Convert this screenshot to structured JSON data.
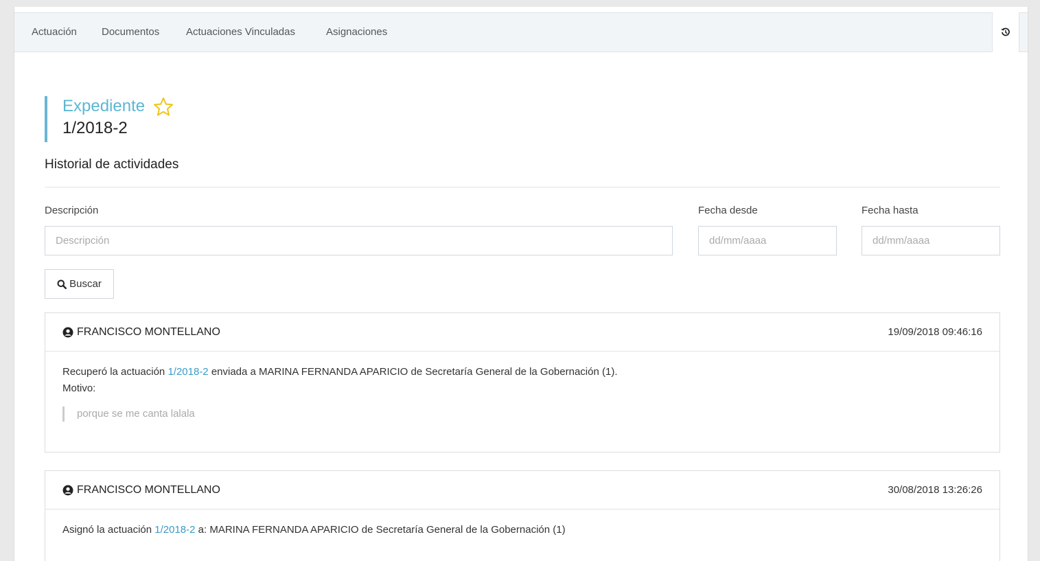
{
  "tabs": [
    "Actuación",
    "Documentos",
    "Actuaciones Vinculadas",
    "Asignaciones"
  ],
  "header": {
    "title": "Expediente",
    "number": "1/2018-2"
  },
  "section_title": "Historial de actividades",
  "filters": {
    "descripcion_label": "Descripción",
    "descripcion_placeholder": "Descripción",
    "desde_label": "Fecha desde",
    "desde_placeholder": "dd/mm/aaaa",
    "hasta_label": "Fecha hasta",
    "hasta_placeholder": "dd/mm/aaaa",
    "search_label": "Buscar"
  },
  "activities": [
    {
      "user": "FRANCISCO MONTELLANO",
      "date": "19/09/2018 09:46:16",
      "text_before": "Recuperó la actuación ",
      "link": "1/2018-2",
      "text_after": " enviada a MARINA FERNANDA APARICIO de Secretaría General de la Gobernación (1).",
      "motivo_label": "Motivo:",
      "motivo": "porque se me canta lalala"
    },
    {
      "user": "FRANCISCO MONTELLANO",
      "date": "30/08/2018 13:26:26",
      "text_before": "Asignó la actuación ",
      "link": "1/2018-2",
      "text_after": " a: MARINA FERNANDA APARICIO de Secretaría General de la Gobernación (1)"
    }
  ],
  "icons": {
    "history": "history-icon",
    "star": "star-outline-icon",
    "search": "search-icon",
    "user": "user-circle-icon"
  },
  "colors": {
    "accent": "#5cb7d3",
    "link": "#3a9bc9",
    "star": "#f0c419"
  }
}
